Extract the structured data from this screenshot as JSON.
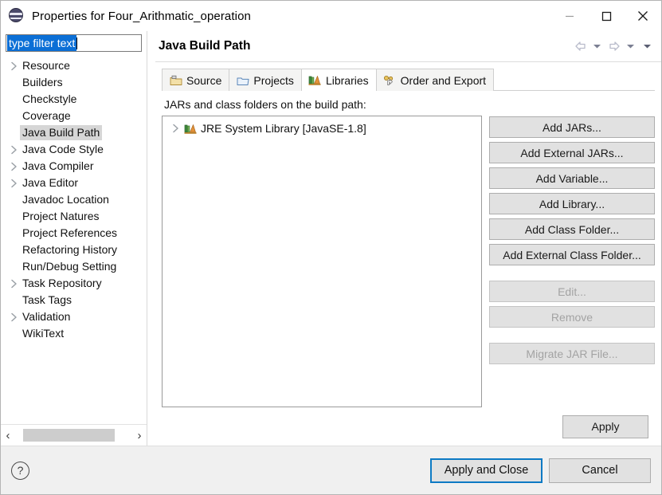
{
  "window": {
    "title": "Properties for Four_Arithmatic_operation",
    "icon": "eclipse-properties-icon",
    "minimize_label": "—",
    "maximize_label": "□",
    "close_label": "✕"
  },
  "sidebar": {
    "filter": {
      "value": "type filter text",
      "placeholder": "type filter text",
      "selected": true
    },
    "items": [
      {
        "label": "Resource",
        "expandable": true,
        "selected": false
      },
      {
        "label": "Builders",
        "expandable": false,
        "selected": false
      },
      {
        "label": "Checkstyle",
        "expandable": false,
        "selected": false
      },
      {
        "label": "Coverage",
        "expandable": false,
        "selected": false
      },
      {
        "label": "Java Build Path",
        "expandable": false,
        "selected": true
      },
      {
        "label": "Java Code Style",
        "expandable": true,
        "selected": false
      },
      {
        "label": "Java Compiler",
        "expandable": true,
        "selected": false
      },
      {
        "label": "Java Editor",
        "expandable": true,
        "selected": false
      },
      {
        "label": "Javadoc Location",
        "expandable": false,
        "selected": false
      },
      {
        "label": "Project Natures",
        "expandable": false,
        "selected": false
      },
      {
        "label": "Project References",
        "expandable": false,
        "selected": false
      },
      {
        "label": "Refactoring History",
        "expandable": false,
        "selected": false
      },
      {
        "label": "Run/Debug Setting",
        "expandable": false,
        "selected": false
      },
      {
        "label": "Task Repository",
        "expandable": true,
        "selected": false
      },
      {
        "label": "Task Tags",
        "expandable": false,
        "selected": false
      },
      {
        "label": "Validation",
        "expandable": true,
        "selected": false
      },
      {
        "label": "WikiText",
        "expandable": false,
        "selected": false
      }
    ],
    "hscroll": {
      "left_arrow": "‹",
      "right_arrow": "›"
    }
  },
  "pane": {
    "title": "Java Build Path",
    "nav": {
      "back_icon": "back-arrow-icon",
      "back_menu_icon": "chevron-down-icon",
      "forward_icon": "forward-arrow-icon",
      "forward_menu_icon": "chevron-down-icon",
      "menu_icon": "chevron-down-icon"
    },
    "tabs": [
      {
        "label": "Source",
        "icon": "source-folder-icon",
        "active": false
      },
      {
        "label": "Projects",
        "icon": "project-icon",
        "active": false
      },
      {
        "label": "Libraries",
        "icon": "library-books-icon",
        "active": true
      },
      {
        "label": "Order and Export",
        "icon": "order-export-icon",
        "active": false
      }
    ],
    "list_caption": "JARs and class folders on the build path:",
    "list_items": [
      {
        "label": "JRE System Library [JavaSE-1.8]",
        "icon": "library-books-icon",
        "expandable": true
      }
    ],
    "buttons": [
      {
        "label": "Add JARs...",
        "enabled": true,
        "gap_before": false
      },
      {
        "label": "Add External JARs...",
        "enabled": true,
        "gap_before": false
      },
      {
        "label": "Add Variable...",
        "enabled": true,
        "gap_before": false
      },
      {
        "label": "Add Library...",
        "enabled": true,
        "gap_before": false
      },
      {
        "label": "Add Class Folder...",
        "enabled": true,
        "gap_before": false
      },
      {
        "label": "Add External Class Folder...",
        "enabled": true,
        "gap_before": false
      },
      {
        "label": "Edit...",
        "enabled": false,
        "gap_before": true
      },
      {
        "label": "Remove",
        "enabled": false,
        "gap_before": false
      },
      {
        "label": "Migrate JAR File...",
        "enabled": false,
        "gap_before": true
      }
    ],
    "apply_label": "Apply"
  },
  "footer": {
    "help_icon": "question-mark-icon",
    "help_label": "?",
    "apply_and_close_label": "Apply and Close",
    "cancel_label": "Cancel"
  },
  "colors": {
    "accent_focus": "#0d7ac4",
    "selection_blue": "#0b6fd6",
    "tree_selection_gray": "#d6d6d6",
    "button_face": "#e1e1e1",
    "footer_bg": "#f0f0f0"
  }
}
